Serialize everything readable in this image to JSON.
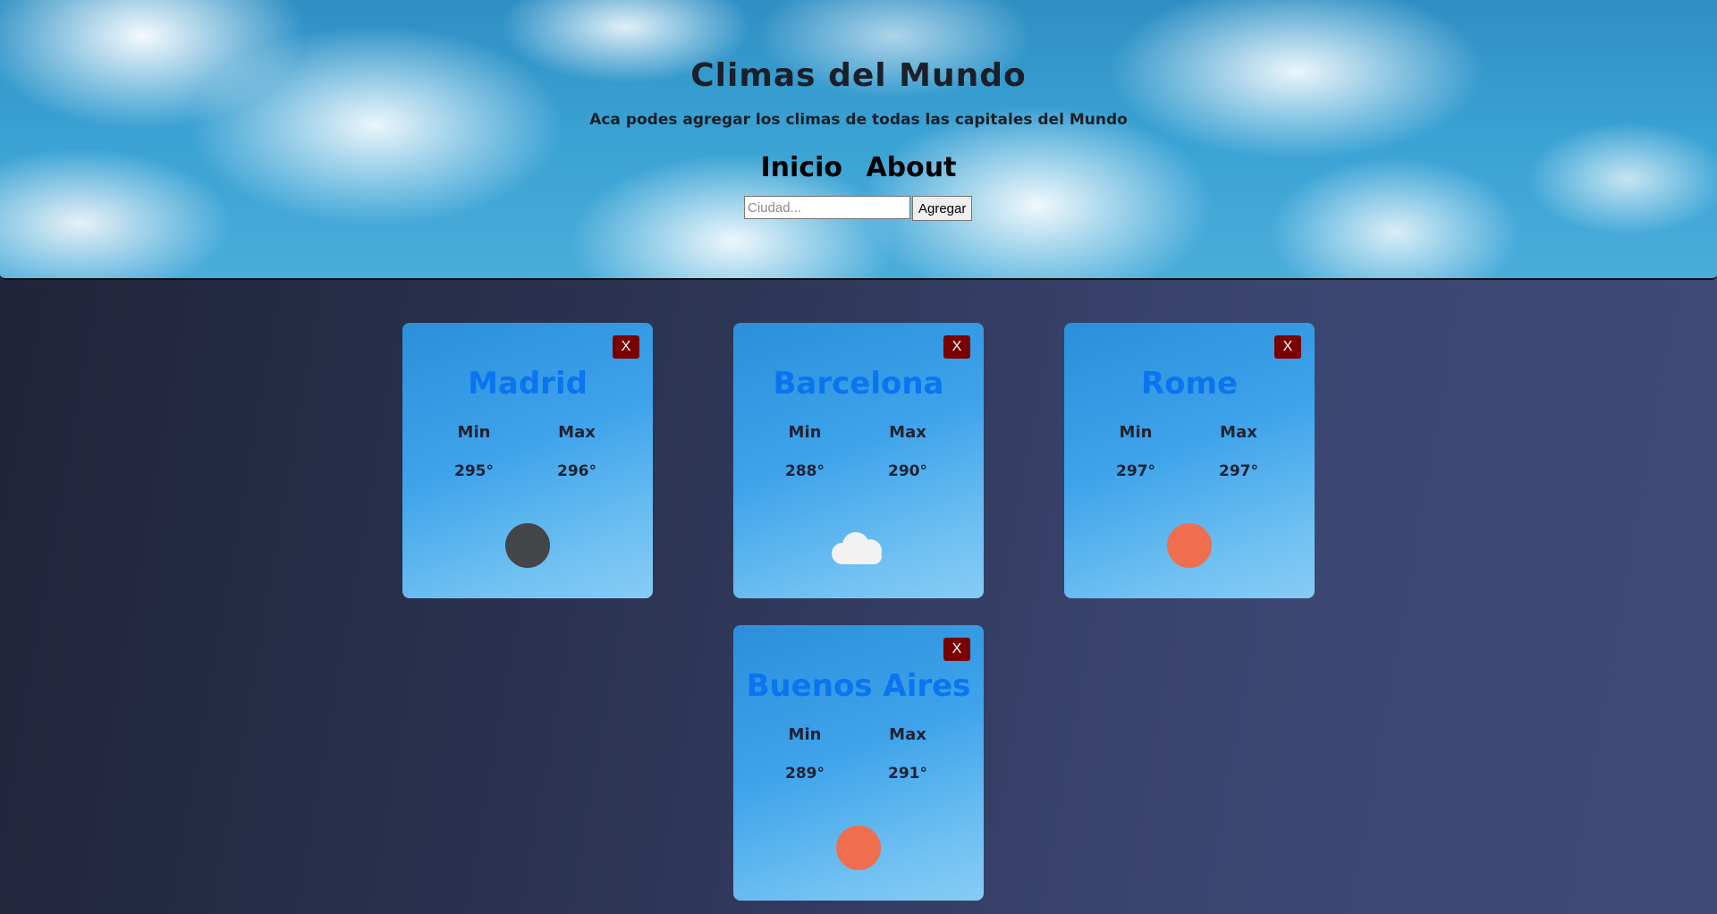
{
  "header": {
    "title": "Climas del Mundo",
    "subtitle": "Aca podes agregar los climas de todas las capitales del Mundo",
    "nav": [
      {
        "label": "Inicio"
      },
      {
        "label": "About"
      }
    ],
    "search": {
      "placeholder": "Ciudad...",
      "value": "",
      "button_label": "Agregar"
    }
  },
  "cards": [
    {
      "city": "Madrid",
      "min_label": "Min",
      "max_label": "Max",
      "min": "295°",
      "max": "296°",
      "icon": "moon-icon",
      "close_label": "X"
    },
    {
      "city": "Barcelona",
      "min_label": "Min",
      "max_label": "Max",
      "min": "288°",
      "max": "290°",
      "icon": "cloud-icon",
      "close_label": "X"
    },
    {
      "city": "Rome",
      "min_label": "Min",
      "max_label": "Max",
      "min": "297°",
      "max": "297°",
      "icon": "sun-icon",
      "close_label": "X"
    },
    {
      "city": "Buenos Aires",
      "min_label": "Min",
      "max_label": "Max",
      "min": "289°",
      "max": "291°",
      "icon": "sun-icon",
      "close_label": "X"
    }
  ],
  "colors": {
    "city_title": "#0b74f0",
    "close_button": "#7a0000",
    "sun": "#ee6e4e",
    "moon": "#444548",
    "cloud": "#f2f2f2"
  }
}
